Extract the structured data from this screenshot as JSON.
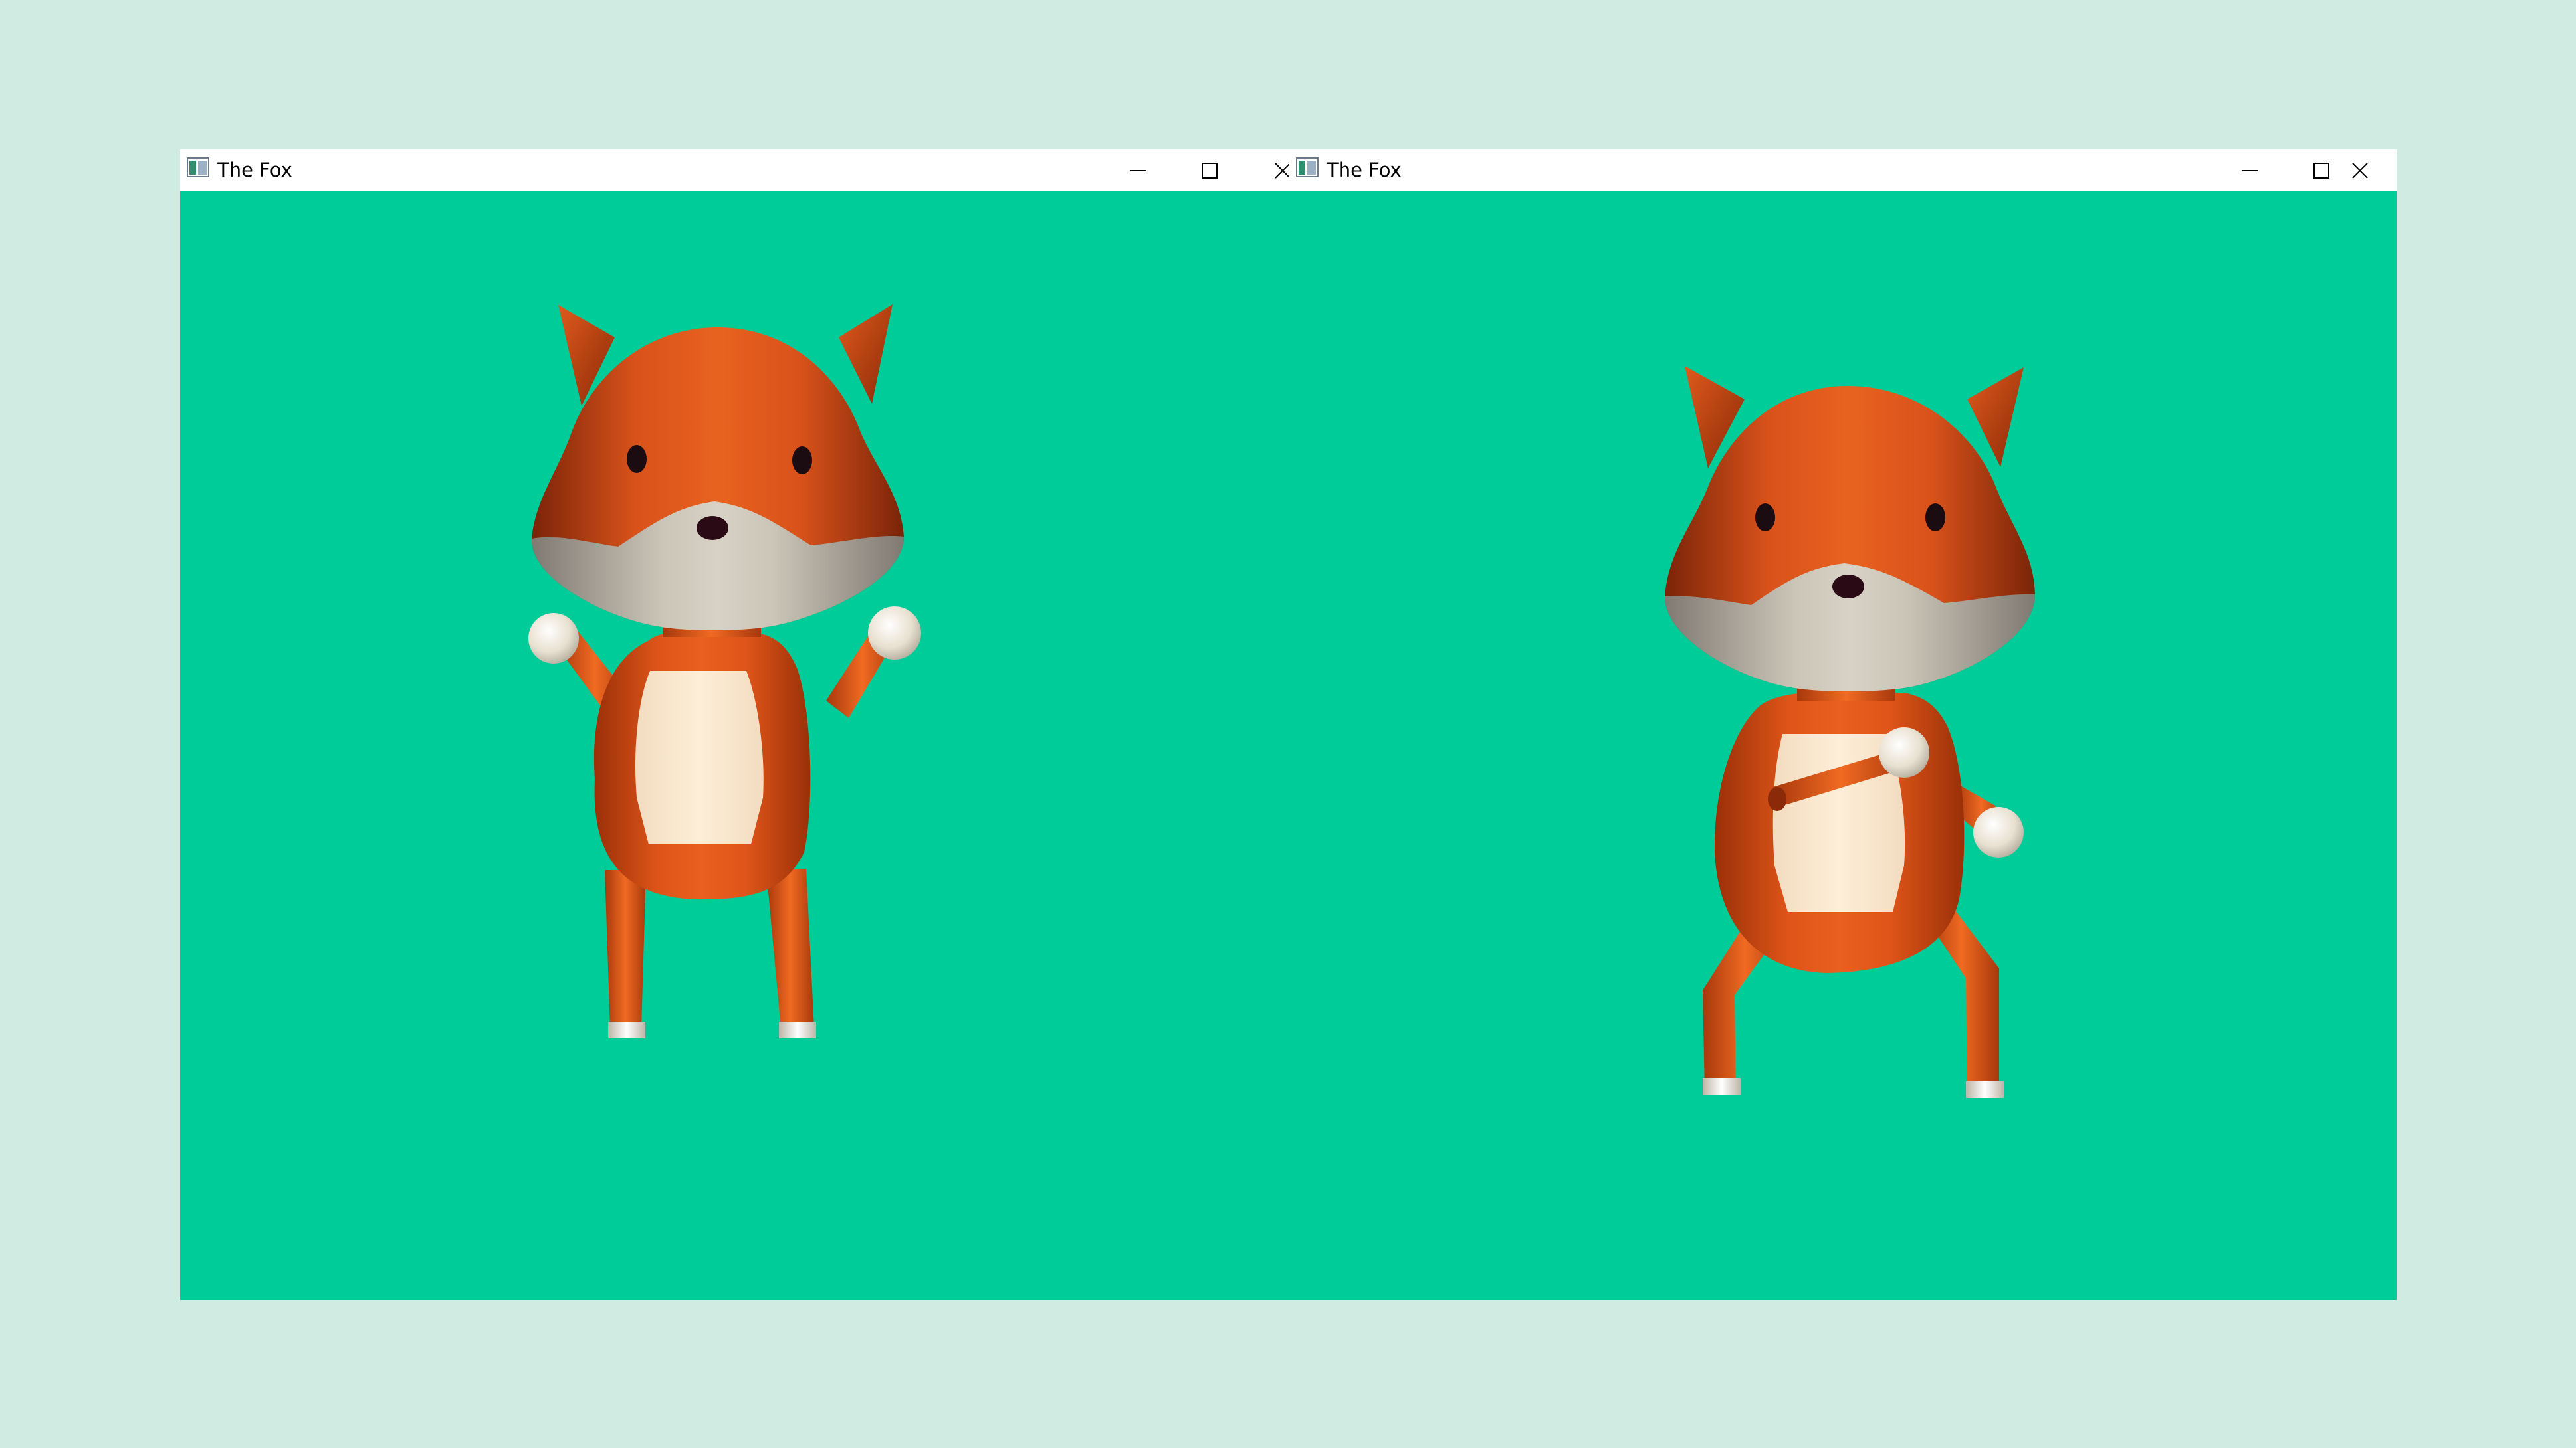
{
  "windows": [
    {
      "title": "The Fox",
      "icon": "app-window-icon",
      "controls": [
        "minimize-icon",
        "maximize-icon",
        "close-icon"
      ]
    },
    {
      "title": "The Fox",
      "icon": "app-window-icon",
      "controls": [
        "minimize-icon",
        "maximize-icon",
        "close-icon"
      ]
    }
  ],
  "colors": {
    "desktop": "#d0ebe2",
    "viewport": "#00cc99",
    "fur": "#e0501a",
    "fur_dark": "#a8300c",
    "muzzle": "#c8c2b4",
    "belly": "#fbe6cc",
    "paw": "#ebe4d6",
    "eye": "#1a0c10"
  }
}
